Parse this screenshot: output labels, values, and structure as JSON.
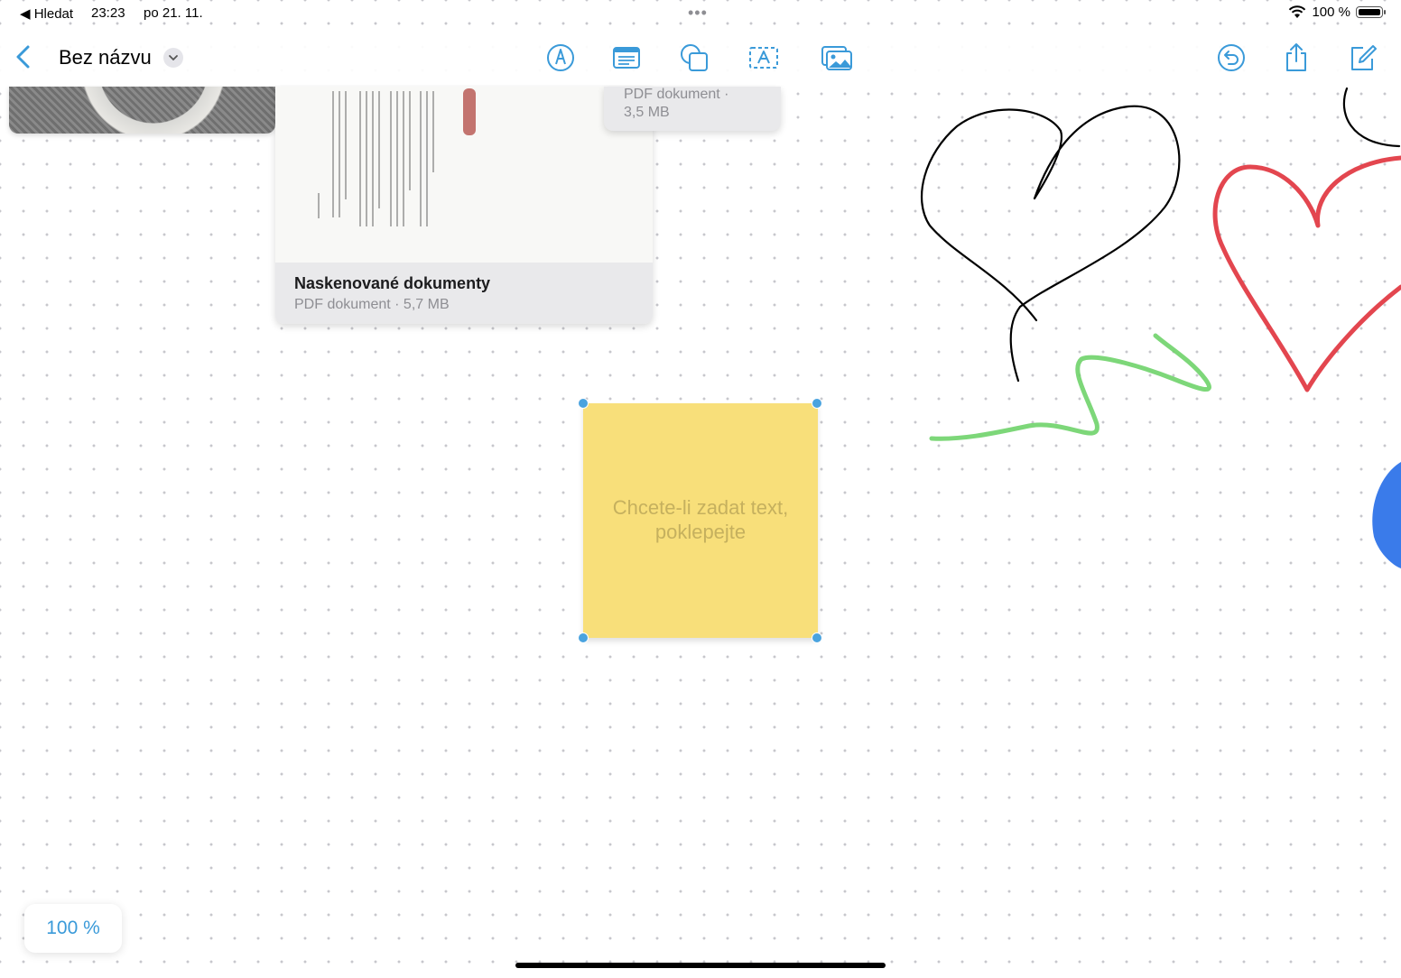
{
  "statusbar": {
    "back_label": "◀ Hledat",
    "time": "23:23",
    "date": "po 21. 11.",
    "battery": "100 %"
  },
  "toolbar": {
    "title": "Bez názvu"
  },
  "board": {
    "scan_card": {
      "title": "Naskenované dokumenty",
      "meta": "PDF dokument · 5,7 MB"
    },
    "pdf_card": {
      "meta_line1": "PDF dokument ·",
      "meta_line2": "3,5 MB"
    },
    "sticky": {
      "text_line1": "Chcete-li zadat text,",
      "text_line2": "poklepejte",
      "color": "#f8df7a"
    },
    "zoom": "100 %"
  },
  "colors": {
    "accent": "#3a9ad9",
    "ink_black": "#000000",
    "ink_red": "#e0323c",
    "ink_green": "#6fd36a",
    "ink_blue": "#3a7bea"
  }
}
